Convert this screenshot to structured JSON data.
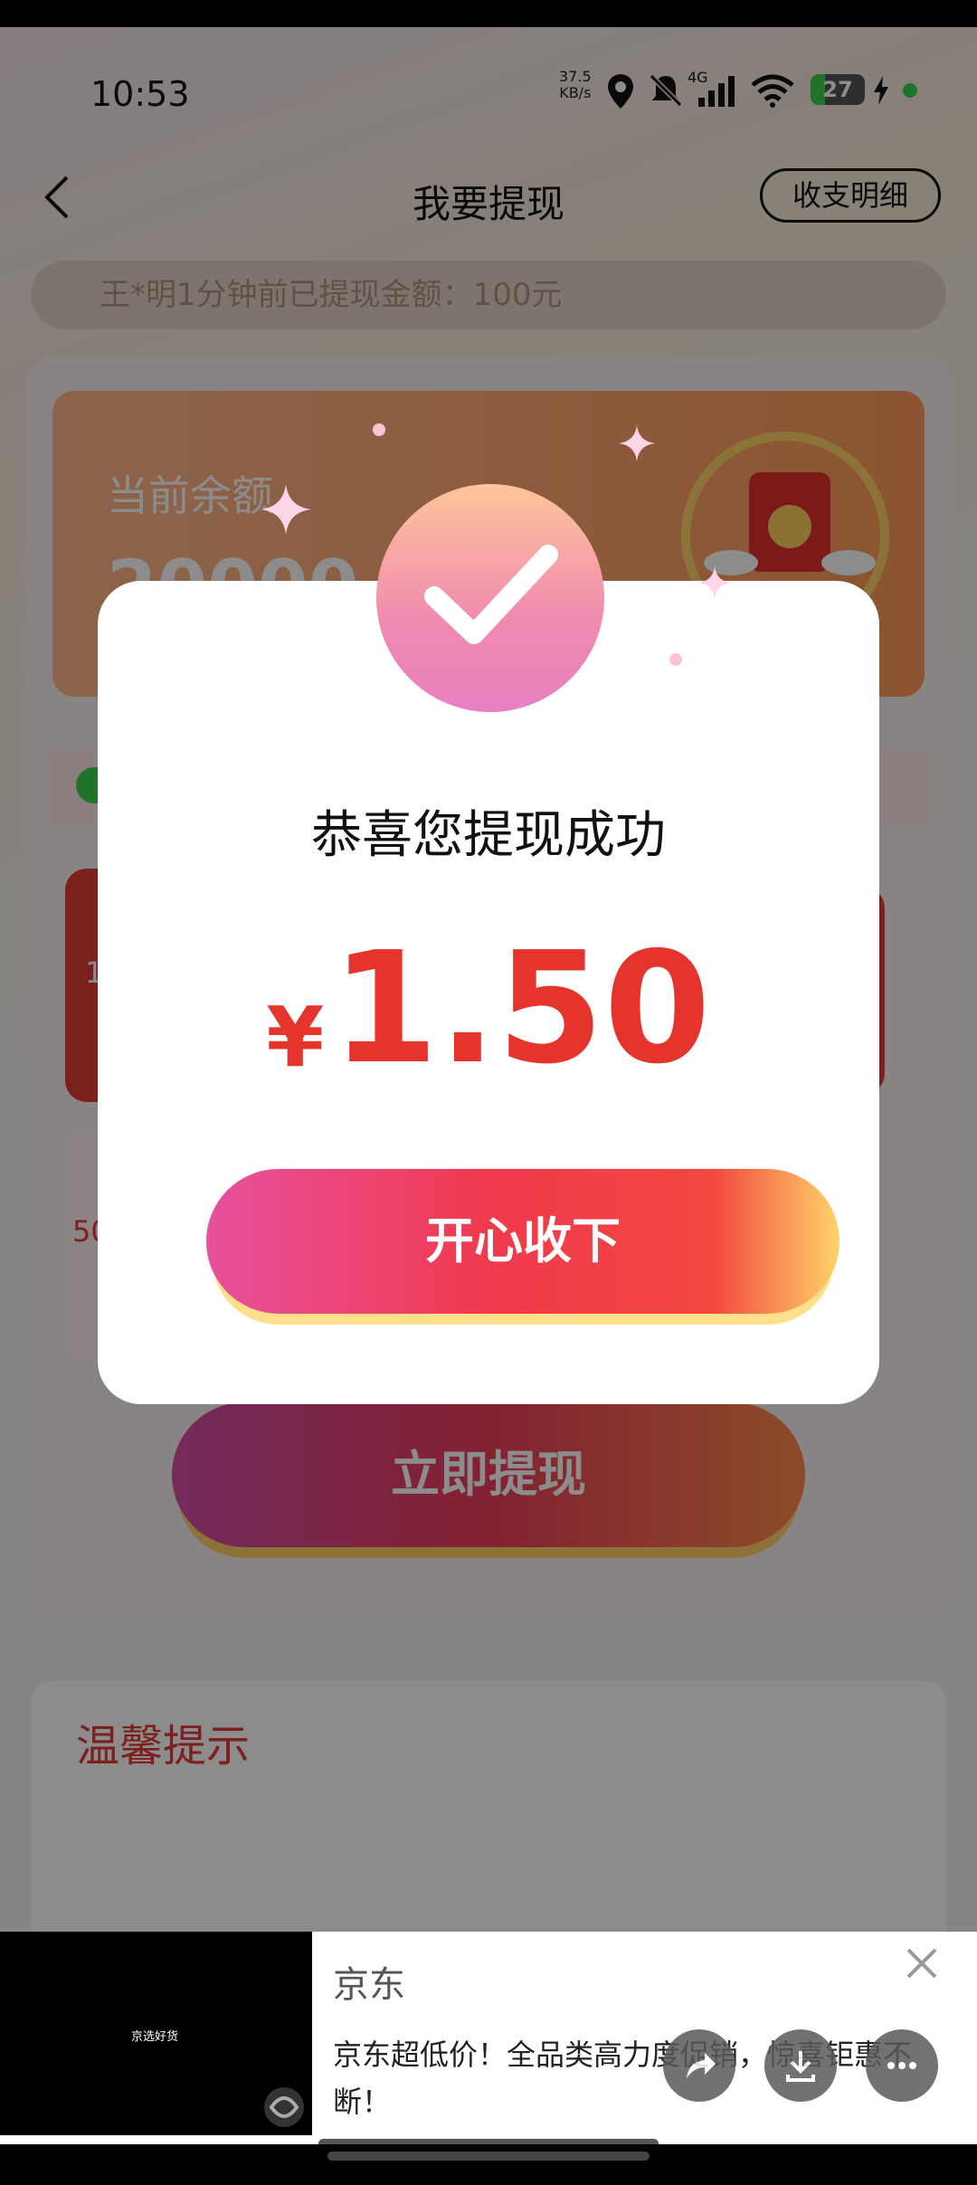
{
  "status": {
    "time": "10:53",
    "net_speed_value": "37.5",
    "net_speed_unit": "KB/s",
    "network": "4G",
    "battery": "27"
  },
  "nav": {
    "title": "我要提现",
    "details_button": "收支明细"
  },
  "ticker": {
    "text": "王*明1分钟前已提现金额：100元"
  },
  "balance": {
    "label": "当前余额",
    "value_partial": "20000"
  },
  "amounts": {
    "left_top": "1",
    "left_bottom": "50"
  },
  "withdraw_button": "立即提现",
  "tips": {
    "title": "温馨提示"
  },
  "dialog": {
    "title": "恭喜您提现成功",
    "currency": "¥",
    "amount": "1.50",
    "button": "开心收下"
  },
  "ad": {
    "brand": "京东",
    "description": "京东超低价！全品类高力度促销，惊喜钜惠不断！",
    "video_caption": "京选好货"
  },
  "colors": {
    "accent_red": "#e5342c",
    "orange": "#ff9a5a",
    "pink": "#f08ab0"
  }
}
